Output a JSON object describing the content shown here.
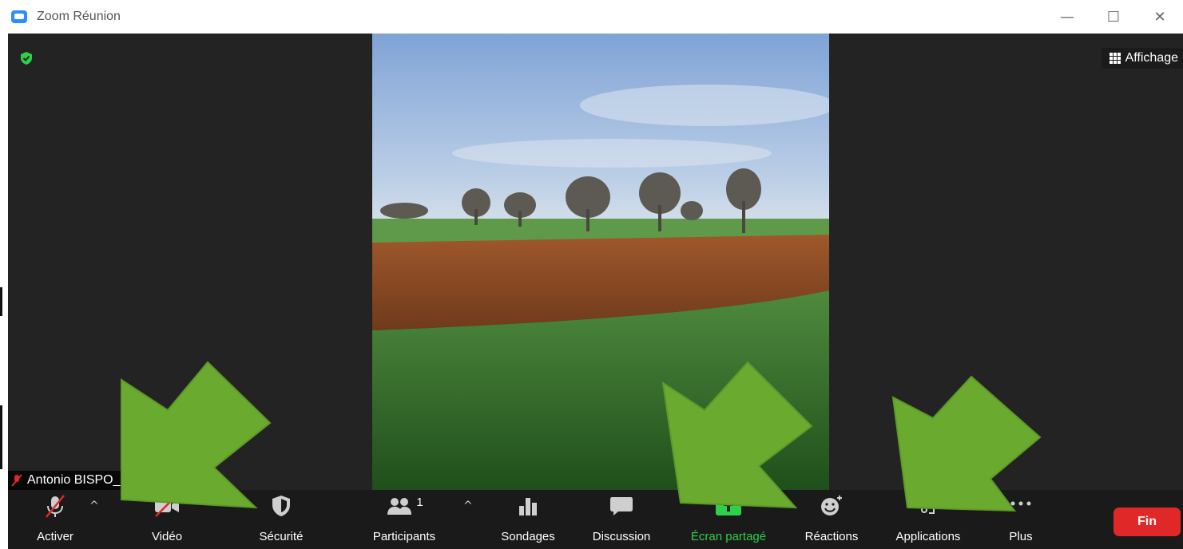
{
  "window": {
    "title": "Zoom Réunion",
    "controls": {
      "minimize": "—",
      "maximize": "☐",
      "close": "✕"
    }
  },
  "meeting": {
    "view_label": "Affichage",
    "participant_name": "Antonio BISPO_",
    "encryption_status": "shield-check-icon"
  },
  "toolbar": {
    "items": [
      {
        "label": "Activer",
        "icon": "mic-muted-icon"
      },
      {
        "label": "Vidéo",
        "icon": "video-off-icon"
      },
      {
        "label": "Sécurité",
        "icon": "shield-icon"
      },
      {
        "label": "Participants",
        "icon": "participants-icon",
        "count": "1"
      },
      {
        "label": "Sondages",
        "icon": "poll-icon"
      },
      {
        "label": "Discussion",
        "icon": "chat-icon"
      },
      {
        "label": "Écran partagé",
        "icon": "share-screen-icon"
      },
      {
        "label": "Réactions",
        "icon": "reactions-icon"
      },
      {
        "label": "Applications",
        "icon": "apps-icon"
      },
      {
        "label": "Plus",
        "icon": "more-icon"
      }
    ],
    "end_label": "Fin",
    "caret": "^"
  },
  "colors": {
    "share_active": "#2ed04a",
    "end_button": "#e02828",
    "arrow_annotation": "#6aaa2f",
    "meeting_bg": "#232323",
    "toolbar_bg": "#1a1a1a"
  }
}
